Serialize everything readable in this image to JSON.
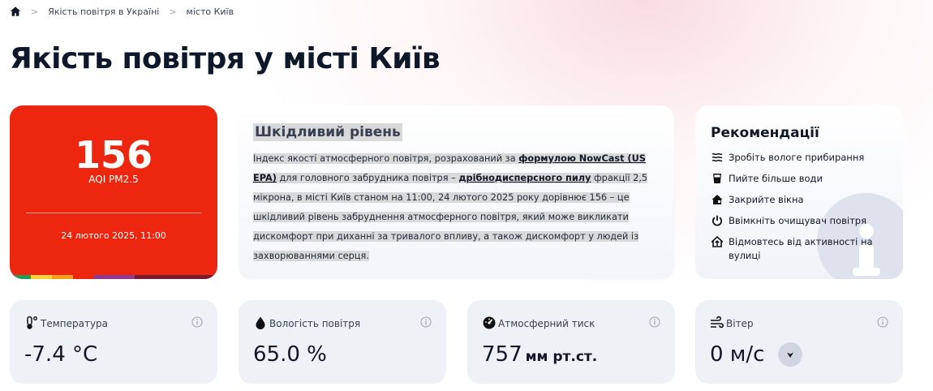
{
  "breadcrumb": {
    "home_icon": "home-icon",
    "items": [
      "Якість повітря в Україні",
      "місто Київ"
    ]
  },
  "title": "Якість повітря у місті Київ",
  "aqi": {
    "value": "156",
    "label": "AQI PM2.5",
    "datetime": "24 лютого 2025, 11:00",
    "color": "#ec260f",
    "scale_colors": [
      "#1d9e52",
      "#f6d33a",
      "#f7a11a",
      "#ec260f",
      "#8d3b91",
      "#7a1b2e"
    ]
  },
  "description": {
    "title": "Шкідливий рівень",
    "text_1": "Індекс якості атмосферного повітря, розрахований за ",
    "link_1": "формулою NowCast (US EPA)",
    "text_2": " для головного забрудника повітря – ",
    "link_2": "дрібнодисперсного пилу",
    "text_3": " фракції 2,5 мікрона, в місті Київ станом на 11:00, 24 лютого 2025 року дорівнює 156 – це шкідливий рівень забруднення атмосферного повітря, який може викликати дискомфорт при диханні за тривалого впливу, а також дискомфорт у людей із захворюваннями серця."
  },
  "recommendations": {
    "title": "Рекомендації",
    "items": [
      {
        "icon": "waves-icon",
        "label": "Зробіть вологе прибирання"
      },
      {
        "icon": "glass-icon",
        "label": "Пийте більше води"
      },
      {
        "icon": "house-icon",
        "label": "Закрийте вікна"
      },
      {
        "icon": "power-icon",
        "label": "Ввімкніть очищувач повітря"
      },
      {
        "icon": "home-exit-icon",
        "label": "Відмовтесь від активності на вулиці"
      }
    ]
  },
  "metrics": {
    "temperature": {
      "label": "Температура",
      "value": "-7.4 °C",
      "icon": "thermometer-icon"
    },
    "humidity": {
      "label": "Вологість повітря",
      "value": "65.0 %",
      "icon": "droplet-icon"
    },
    "pressure": {
      "label": "Атмосферний тиск",
      "value": "757",
      "unit": "мм рт.ст.",
      "icon": "gauge-icon"
    },
    "wind": {
      "label": "Вітер",
      "value": "0 м/с",
      "icon": "wind-icon",
      "direction_icon": "chevron-down-icon"
    }
  }
}
